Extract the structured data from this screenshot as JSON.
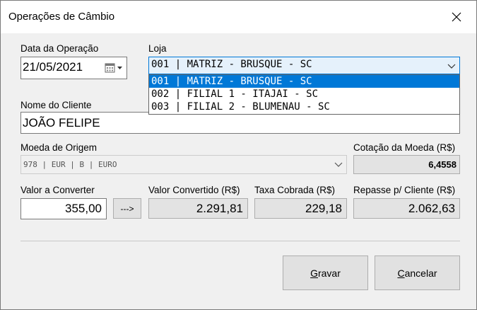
{
  "window": {
    "title": "Operações de Câmbio",
    "close_glyph": "✕"
  },
  "date": {
    "label": "Data da Operação",
    "value": "21/05/2021"
  },
  "store": {
    "label": "Loja",
    "selected": "001 | MATRIZ - BRUSQUE - SC",
    "options": [
      "001 | MATRIZ - BRUSQUE - SC",
      "002 | FILIAL 1 - ITAJAI - SC",
      "003 | FILIAL 2 - BLUMENAU - SC"
    ],
    "highlighted_index": 0
  },
  "client": {
    "label": "Nome do Cliente",
    "value": "JOÃO FELIPE"
  },
  "currency": {
    "label": "Moeda de Origem",
    "selected": "978 | EUR | B | EURO"
  },
  "rate": {
    "label": "Cotação da Moeda (R$)",
    "value": "6,4558"
  },
  "amount": {
    "label": "Valor a Converter",
    "value": "355,00"
  },
  "convert_button": {
    "label": "--->"
  },
  "converted": {
    "label": "Valor Convertido (R$)",
    "value": "2.291,81"
  },
  "fee": {
    "label": "Taxa Cobrada (R$)",
    "value": "229,18"
  },
  "transfer": {
    "label": "Repasse p/ Cliente (R$)",
    "value": "2.062,63"
  },
  "actions": {
    "save": {
      "label_first": "G",
      "label_rest": "ravar"
    },
    "cancel": {
      "label_first": "C",
      "label_rest": "ancelar"
    }
  },
  "colors": {
    "selection": "#0078d7",
    "readonly_bg": "#e3e3e3",
    "window_bg": "#f0f0f0"
  },
  "icons": [
    "calendar-icon",
    "chevron-down-icon",
    "close-icon"
  ]
}
